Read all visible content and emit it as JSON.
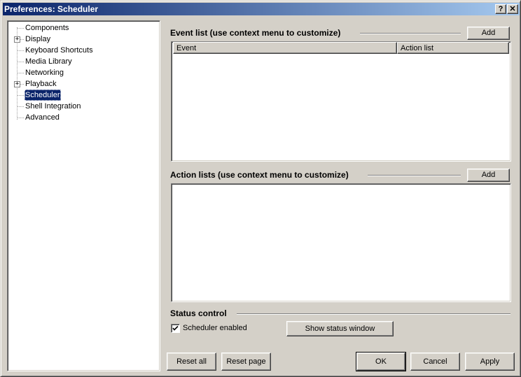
{
  "window": {
    "title": "Preferences: Scheduler",
    "help_glyph": "?",
    "close_glyph": "✕"
  },
  "tree": {
    "items": [
      {
        "label": "Components",
        "expandable": false
      },
      {
        "label": "Display",
        "expandable": true
      },
      {
        "label": "Keyboard Shortcuts",
        "expandable": false
      },
      {
        "label": "Media Library",
        "expandable": false
      },
      {
        "label": "Networking",
        "expandable": false
      },
      {
        "label": "Playback",
        "expandable": true
      },
      {
        "label": "Scheduler",
        "expandable": false,
        "selected": true
      },
      {
        "label": "Shell Integration",
        "expandable": false
      },
      {
        "label": "Advanced",
        "expandable": false
      }
    ],
    "expander_glyph": "+"
  },
  "event_list": {
    "heading": "Event list (use context menu to customize)",
    "add_label": "Add",
    "columns": [
      "Event",
      "Action list"
    ],
    "rows": []
  },
  "action_lists": {
    "heading": "Action lists (use context menu to customize)",
    "add_label": "Add",
    "items": []
  },
  "status_control": {
    "heading": "Status control",
    "checkbox_label": "Scheduler enabled",
    "checked": true,
    "show_window_label": "Show status window"
  },
  "footer": {
    "reset_all": "Reset all",
    "reset_page": "Reset page",
    "ok": "OK",
    "cancel": "Cancel",
    "apply": "Apply"
  },
  "colors": {
    "face": "#d4d0c8",
    "selection": "#0a246a",
    "title_start": "#0a246a",
    "title_end": "#a6caf0"
  }
}
